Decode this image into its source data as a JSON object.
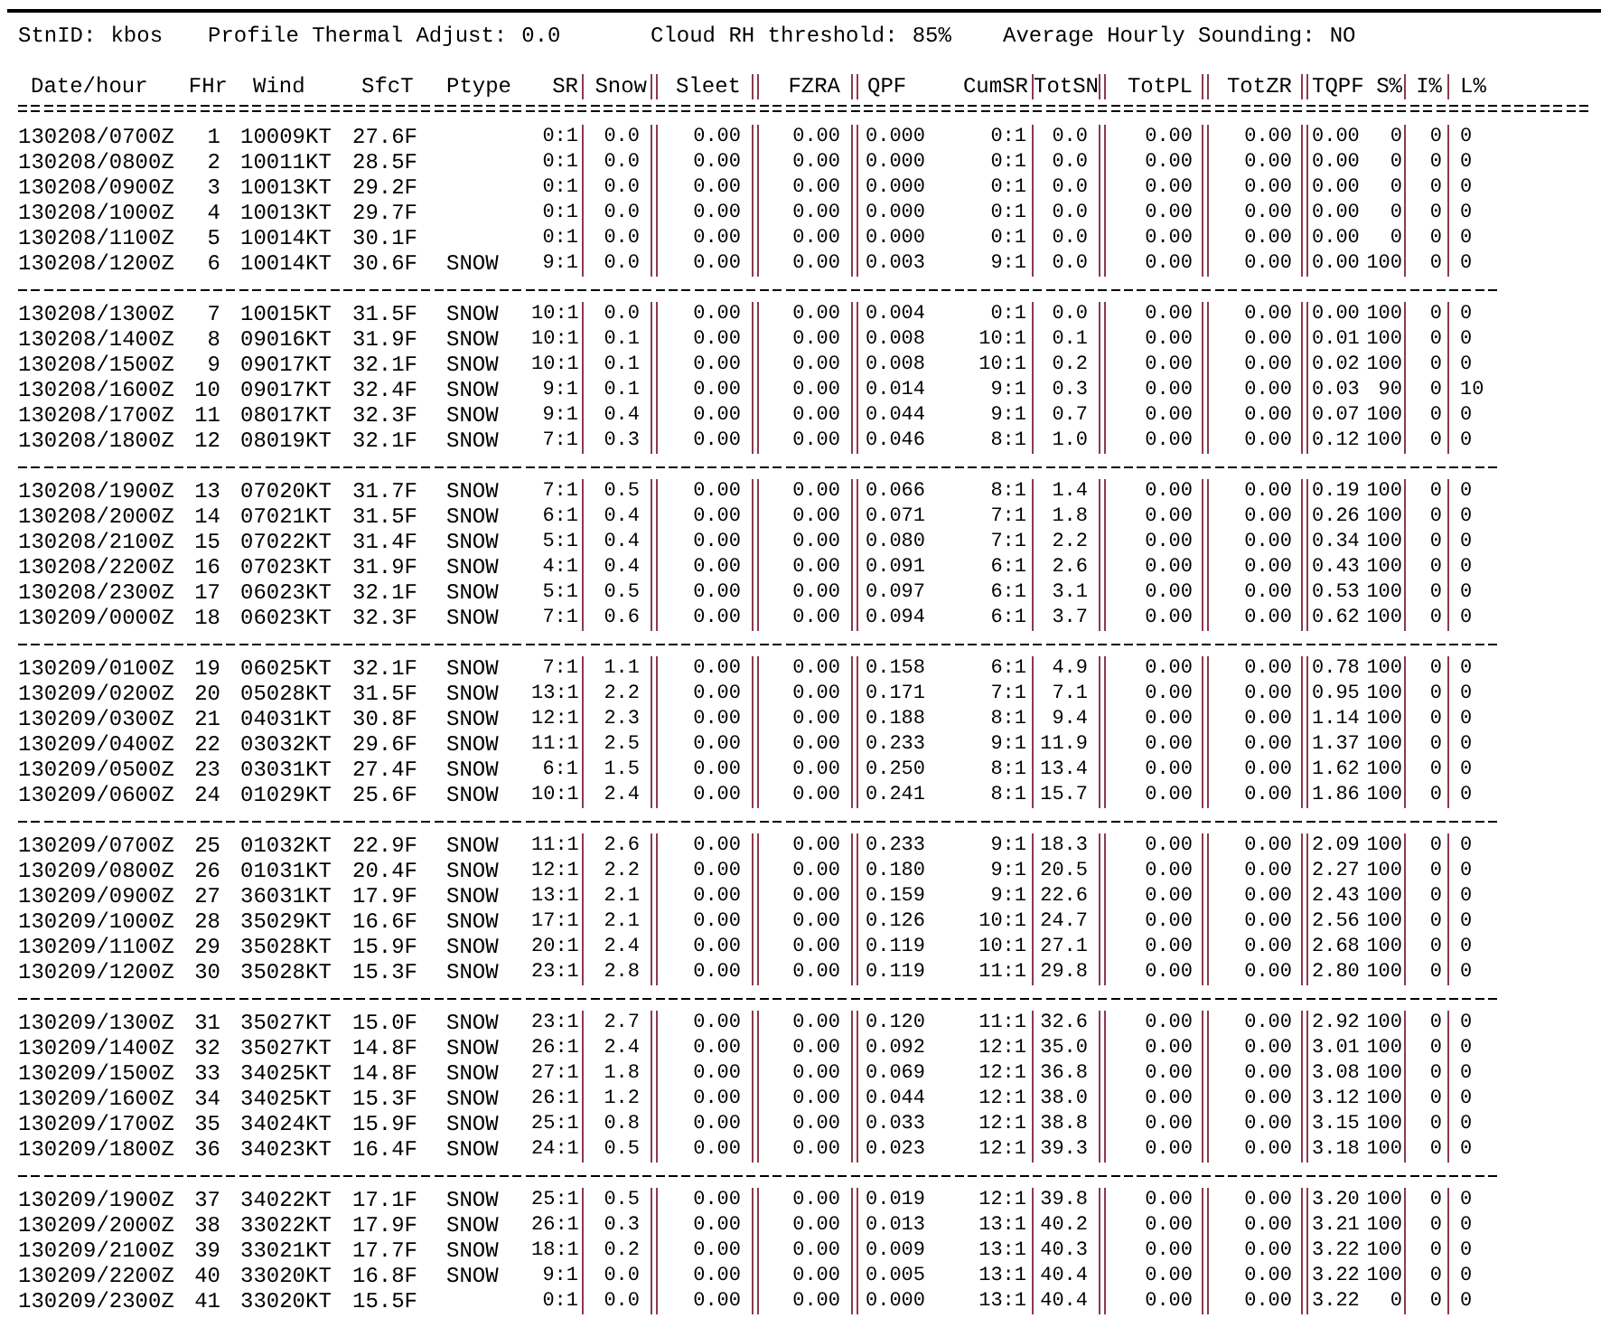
{
  "settings": [
    {
      "label": "StnID:",
      "value": "kbos"
    },
    {
      "label": "Profile Thermal Adjust:",
      "value": "0.0"
    },
    {
      "label": "Cloud RH threshold:",
      "value": "85%"
    },
    {
      "label": "Average Hourly Sounding:",
      "value": "NO"
    }
  ],
  "columns": [
    "Date/hour",
    "FHr",
    "Wind",
    "SfcT",
    "Ptype",
    "SR",
    "Snow",
    "Sleet",
    "FZRA",
    "QPF",
    "CumSR",
    "TotSN",
    "TotPL",
    "TotZR",
    "TQPF",
    "S%",
    "I%",
    "L%"
  ],
  "groups": [
    [
      {
        "c": [
          "130208/0700Z",
          "1",
          "10009KT",
          "27.6F",
          "0:1",
          "0.0",
          "0.00",
          "0.00",
          "0.000",
          "0:1",
          "0.0",
          "0.00",
          "0.00",
          "0.00",
          "0",
          "0",
          "0"
        ]
      },
      {
        "c": [
          "130208/0800Z",
          "2",
          "10011KT",
          "28.5F",
          "0:1",
          "0.0",
          "0.00",
          "0.00",
          "0.000",
          "0:1",
          "0.0",
          "0.00",
          "0.00",
          "0.00",
          "0",
          "0",
          "0"
        ]
      },
      {
        "c": [
          "130208/0900Z",
          "3",
          "10013KT",
          "29.2F",
          "0:1",
          "0.0",
          "0.00",
          "0.00",
          "0.000",
          "0:1",
          "0.0",
          "0.00",
          "0.00",
          "0.00",
          "0",
          "0",
          "0"
        ]
      },
      {
        "c": [
          "130208/1000Z",
          "4",
          "10013KT",
          "29.7F",
          "0:1",
          "0.0",
          "0.00",
          "0.00",
          "0.000",
          "0:1",
          "0.0",
          "0.00",
          "0.00",
          "0.00",
          "0",
          "0",
          "0"
        ]
      },
      {
        "c": [
          "130208/1100Z",
          "5",
          "10014KT",
          "30.1F",
          "0:1",
          "0.0",
          "0.00",
          "0.00",
          "0.000",
          "0:1",
          "0.0",
          "0.00",
          "0.00",
          "0.00",
          "0",
          "0",
          "0"
        ]
      },
      {
        "ptype": "SNOW",
        "c": [
          "130208/1200Z",
          "6",
          "10014KT",
          "30.6F",
          "9:1",
          "0.0",
          "0.00",
          "0.00",
          "0.003",
          "9:1",
          "0.0",
          "0.00",
          "0.00",
          "0.00",
          "100",
          "0",
          "0"
        ]
      }
    ],
    [
      {
        "ptype": "SNOW",
        "c": [
          "130208/1300Z",
          "7",
          "10015KT",
          "31.5F",
          "10:1",
          "0.0",
          "0.00",
          "0.00",
          "0.004",
          "0:1",
          "0.0",
          "0.00",
          "0.00",
          "0.00",
          "100",
          "0",
          "0"
        ]
      },
      {
        "ptype": "SNOW",
        "c": [
          "130208/1400Z",
          "8",
          "09016KT",
          "31.9F",
          "10:1",
          "0.1",
          "0.00",
          "0.00",
          "0.008",
          "10:1",
          "0.1",
          "0.00",
          "0.00",
          "0.01",
          "100",
          "0",
          "0"
        ]
      },
      {
        "ptype": "SNOW",
        "c": [
          "130208/1500Z",
          "9",
          "09017KT",
          "32.1F",
          "10:1",
          "0.1",
          "0.00",
          "0.00",
          "0.008",
          "10:1",
          "0.2",
          "0.00",
          "0.00",
          "0.02",
          "100",
          "0",
          "0"
        ]
      },
      {
        "ptype": "SNOW",
        "c": [
          "130208/1600Z",
          "10",
          "09017KT",
          "32.4F",
          "9:1",
          "0.1",
          "0.00",
          "0.00",
          "0.014",
          "9:1",
          "0.3",
          "0.00",
          "0.00",
          "0.03",
          "90",
          "0",
          "10"
        ]
      },
      {
        "ptype": "SNOW",
        "c": [
          "130208/1700Z",
          "11",
          "08017KT",
          "32.3F",
          "9:1",
          "0.4",
          "0.00",
          "0.00",
          "0.044",
          "9:1",
          "0.7",
          "0.00",
          "0.00",
          "0.07",
          "100",
          "0",
          "0"
        ]
      },
      {
        "ptype": "SNOW",
        "c": [
          "130208/1800Z",
          "12",
          "08019KT",
          "32.1F",
          "7:1",
          "0.3",
          "0.00",
          "0.00",
          "0.046",
          "8:1",
          "1.0",
          "0.00",
          "0.00",
          "0.12",
          "100",
          "0",
          "0"
        ]
      }
    ],
    [
      {
        "ptype": "SNOW",
        "c": [
          "130208/1900Z",
          "13",
          "07020KT",
          "31.7F",
          "7:1",
          "0.5",
          "0.00",
          "0.00",
          "0.066",
          "8:1",
          "1.4",
          "0.00",
          "0.00",
          "0.19",
          "100",
          "0",
          "0"
        ]
      },
      {
        "ptype": "SNOW",
        "c": [
          "130208/2000Z",
          "14",
          "07021KT",
          "31.5F",
          "6:1",
          "0.4",
          "0.00",
          "0.00",
          "0.071",
          "7:1",
          "1.8",
          "0.00",
          "0.00",
          "0.26",
          "100",
          "0",
          "0"
        ]
      },
      {
        "ptype": "SNOW",
        "c": [
          "130208/2100Z",
          "15",
          "07022KT",
          "31.4F",
          "5:1",
          "0.4",
          "0.00",
          "0.00",
          "0.080",
          "7:1",
          "2.2",
          "0.00",
          "0.00",
          "0.34",
          "100",
          "0",
          "0"
        ]
      },
      {
        "ptype": "SNOW",
        "c": [
          "130208/2200Z",
          "16",
          "07023KT",
          "31.9F",
          "4:1",
          "0.4",
          "0.00",
          "0.00",
          "0.091",
          "6:1",
          "2.6",
          "0.00",
          "0.00",
          "0.43",
          "100",
          "0",
          "0"
        ]
      },
      {
        "ptype": "SNOW",
        "c": [
          "130208/2300Z",
          "17",
          "06023KT",
          "32.1F",
          "5:1",
          "0.5",
          "0.00",
          "0.00",
          "0.097",
          "6:1",
          "3.1",
          "0.00",
          "0.00",
          "0.53",
          "100",
          "0",
          "0"
        ]
      },
      {
        "ptype": "SNOW",
        "c": [
          "130209/0000Z",
          "18",
          "06023KT",
          "32.3F",
          "7:1",
          "0.6",
          "0.00",
          "0.00",
          "0.094",
          "6:1",
          "3.7",
          "0.00",
          "0.00",
          "0.62",
          "100",
          "0",
          "0"
        ]
      }
    ],
    [
      {
        "ptype": "SNOW",
        "c": [
          "130209/0100Z",
          "19",
          "06025KT",
          "32.1F",
          "7:1",
          "1.1",
          "0.00",
          "0.00",
          "0.158",
          "6:1",
          "4.9",
          "0.00",
          "0.00",
          "0.78",
          "100",
          "0",
          "0"
        ]
      },
      {
        "ptype": "SNOW",
        "c": [
          "130209/0200Z",
          "20",
          "05028KT",
          "31.5F",
          "13:1",
          "2.2",
          "0.00",
          "0.00",
          "0.171",
          "7:1",
          "7.1",
          "0.00",
          "0.00",
          "0.95",
          "100",
          "0",
          "0"
        ]
      },
      {
        "ptype": "SNOW",
        "c": [
          "130209/0300Z",
          "21",
          "04031KT",
          "30.8F",
          "12:1",
          "2.3",
          "0.00",
          "0.00",
          "0.188",
          "8:1",
          "9.4",
          "0.00",
          "0.00",
          "1.14",
          "100",
          "0",
          "0"
        ]
      },
      {
        "ptype": "SNOW",
        "c": [
          "130209/0400Z",
          "22",
          "03032KT",
          "29.6F",
          "11:1",
          "2.5",
          "0.00",
          "0.00",
          "0.233",
          "9:1",
          "11.9",
          "0.00",
          "0.00",
          "1.37",
          "100",
          "0",
          "0"
        ]
      },
      {
        "ptype": "SNOW",
        "c": [
          "130209/0500Z",
          "23",
          "03031KT",
          "27.4F",
          "6:1",
          "1.5",
          "0.00",
          "0.00",
          "0.250",
          "8:1",
          "13.4",
          "0.00",
          "0.00",
          "1.62",
          "100",
          "0",
          "0"
        ]
      },
      {
        "ptype": "SNOW",
        "c": [
          "130209/0600Z",
          "24",
          "01029KT",
          "25.6F",
          "10:1",
          "2.4",
          "0.00",
          "0.00",
          "0.241",
          "8:1",
          "15.7",
          "0.00",
          "0.00",
          "1.86",
          "100",
          "0",
          "0"
        ]
      }
    ],
    [
      {
        "ptype": "SNOW",
        "c": [
          "130209/0700Z",
          "25",
          "01032KT",
          "22.9F",
          "11:1",
          "2.6",
          "0.00",
          "0.00",
          "0.233",
          "9:1",
          "18.3",
          "0.00",
          "0.00",
          "2.09",
          "100",
          "0",
          "0"
        ]
      },
      {
        "ptype": "SNOW",
        "c": [
          "130209/0800Z",
          "26",
          "01031KT",
          "20.4F",
          "12:1",
          "2.2",
          "0.00",
          "0.00",
          "0.180",
          "9:1",
          "20.5",
          "0.00",
          "0.00",
          "2.27",
          "100",
          "0",
          "0"
        ]
      },
      {
        "ptype": "SNOW",
        "c": [
          "130209/0900Z",
          "27",
          "36031KT",
          "17.9F",
          "13:1",
          "2.1",
          "0.00",
          "0.00",
          "0.159",
          "9:1",
          "22.6",
          "0.00",
          "0.00",
          "2.43",
          "100",
          "0",
          "0"
        ]
      },
      {
        "ptype": "SNOW",
        "c": [
          "130209/1000Z",
          "28",
          "35029KT",
          "16.6F",
          "17:1",
          "2.1",
          "0.00",
          "0.00",
          "0.126",
          "10:1",
          "24.7",
          "0.00",
          "0.00",
          "2.56",
          "100",
          "0",
          "0"
        ]
      },
      {
        "ptype": "SNOW",
        "c": [
          "130209/1100Z",
          "29",
          "35028KT",
          "15.9F",
          "20:1",
          "2.4",
          "0.00",
          "0.00",
          "0.119",
          "10:1",
          "27.1",
          "0.00",
          "0.00",
          "2.68",
          "100",
          "0",
          "0"
        ]
      },
      {
        "ptype": "SNOW",
        "c": [
          "130209/1200Z",
          "30",
          "35028KT",
          "15.3F",
          "23:1",
          "2.8",
          "0.00",
          "0.00",
          "0.119",
          "11:1",
          "29.8",
          "0.00",
          "0.00",
          "2.80",
          "100",
          "0",
          "0"
        ]
      }
    ],
    [
      {
        "ptype": "SNOW",
        "c": [
          "130209/1300Z",
          "31",
          "35027KT",
          "15.0F",
          "23:1",
          "2.7",
          "0.00",
          "0.00",
          "0.120",
          "11:1",
          "32.6",
          "0.00",
          "0.00",
          "2.92",
          "100",
          "0",
          "0"
        ]
      },
      {
        "ptype": "SNOW",
        "c": [
          "130209/1400Z",
          "32",
          "35027KT",
          "14.8F",
          "26:1",
          "2.4",
          "0.00",
          "0.00",
          "0.092",
          "12:1",
          "35.0",
          "0.00",
          "0.00",
          "3.01",
          "100",
          "0",
          "0"
        ]
      },
      {
        "ptype": "SNOW",
        "c": [
          "130209/1500Z",
          "33",
          "34025KT",
          "14.8F",
          "27:1",
          "1.8",
          "0.00",
          "0.00",
          "0.069",
          "12:1",
          "36.8",
          "0.00",
          "0.00",
          "3.08",
          "100",
          "0",
          "0"
        ]
      },
      {
        "ptype": "SNOW",
        "c": [
          "130209/1600Z",
          "34",
          "34025KT",
          "15.3F",
          "26:1",
          "1.2",
          "0.00",
          "0.00",
          "0.044",
          "12:1",
          "38.0",
          "0.00",
          "0.00",
          "3.12",
          "100",
          "0",
          "0"
        ]
      },
      {
        "ptype": "SNOW",
        "c": [
          "130209/1700Z",
          "35",
          "34024KT",
          "15.9F",
          "25:1",
          "0.8",
          "0.00",
          "0.00",
          "0.033",
          "12:1",
          "38.8",
          "0.00",
          "0.00",
          "3.15",
          "100",
          "0",
          "0"
        ]
      },
      {
        "ptype": "SNOW",
        "c": [
          "130209/1800Z",
          "36",
          "34023KT",
          "16.4F",
          "24:1",
          "0.5",
          "0.00",
          "0.00",
          "0.023",
          "12:1",
          "39.3",
          "0.00",
          "0.00",
          "3.18",
          "100",
          "0",
          "0"
        ]
      }
    ],
    [
      {
        "ptype": "SNOW",
        "c": [
          "130209/1900Z",
          "37",
          "34022KT",
          "17.1F",
          "25:1",
          "0.5",
          "0.00",
          "0.00",
          "0.019",
          "12:1",
          "39.8",
          "0.00",
          "0.00",
          "3.20",
          "100",
          "0",
          "0"
        ]
      },
      {
        "ptype": "SNOW",
        "c": [
          "130209/2000Z",
          "38",
          "33022KT",
          "17.9F",
          "26:1",
          "0.3",
          "0.00",
          "0.00",
          "0.013",
          "13:1",
          "40.2",
          "0.00",
          "0.00",
          "3.21",
          "100",
          "0",
          "0"
        ]
      },
      {
        "ptype": "SNOW",
        "c": [
          "130209/2100Z",
          "39",
          "33021KT",
          "17.7F",
          "18:1",
          "0.2",
          "0.00",
          "0.00",
          "0.009",
          "13:1",
          "40.3",
          "0.00",
          "0.00",
          "3.22",
          "100",
          "0",
          "0"
        ]
      },
      {
        "ptype": "SNOW",
        "c": [
          "130209/2200Z",
          "40",
          "33020KT",
          "16.8F",
          "9:1",
          "0.0",
          "0.00",
          "0.00",
          "0.005",
          "13:1",
          "40.4",
          "0.00",
          "0.00",
          "3.22",
          "100",
          "0",
          "0"
        ]
      },
      {
        "c": [
          "130209/2300Z",
          "41",
          "33020KT",
          "15.5F",
          "0:1",
          "0.0",
          "0.00",
          "0.00",
          "0.000",
          "13:1",
          "40.4",
          "0.00",
          "0.00",
          "3.22",
          "0",
          "0",
          "0"
        ]
      }
    ]
  ]
}
